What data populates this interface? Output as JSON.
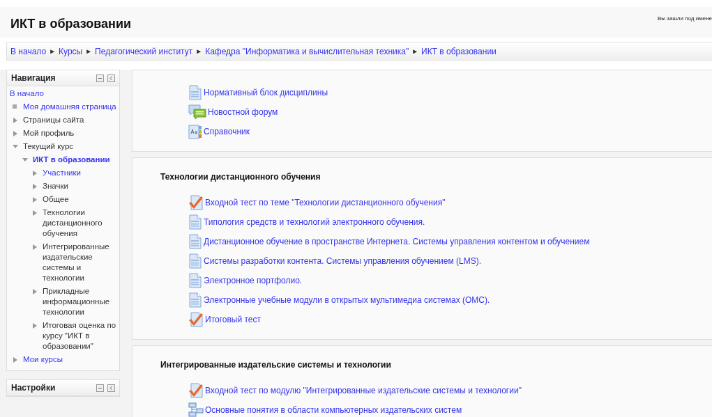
{
  "header": {
    "title": "ИКТ в образовании",
    "login_info": "Вы зашли под имене"
  },
  "breadcrumbs": [
    {
      "label": "В начало"
    },
    {
      "label": "Курсы"
    },
    {
      "label": "Педагогический институт"
    },
    {
      "label": "Кафедра \"Информатика и вычислительная техника\""
    },
    {
      "label": "ИКТ в образовании"
    }
  ],
  "breadcrumb_separator": "►",
  "navigation": {
    "title": "Навигация",
    "items": [
      {
        "label": "В начало",
        "kind": "root",
        "link": true,
        "selected": false
      },
      {
        "label": "Моя домашняя страница",
        "kind": "leaf",
        "link": true,
        "selected": false
      },
      {
        "label": "Страницы сайта",
        "kind": "branch",
        "expanded": false,
        "link": false,
        "selected": false
      },
      {
        "label": "Мой профиль",
        "kind": "branch",
        "expanded": false,
        "link": false,
        "selected": false
      },
      {
        "label": "Текущий курс",
        "kind": "branch",
        "expanded": true,
        "link": false,
        "selected": false,
        "children": [
          {
            "label": "ИКТ в образовании",
            "kind": "branch",
            "expanded": true,
            "link": true,
            "selected": true,
            "children": [
              {
                "label": "Участники",
                "kind": "branch",
                "expanded": false,
                "link": true,
                "selected": false
              },
              {
                "label": "Значки",
                "kind": "branch",
                "expanded": false,
                "link": false,
                "selected": false
              },
              {
                "label": "Общее",
                "kind": "branch",
                "expanded": false,
                "link": false,
                "selected": false
              },
              {
                "label": "Технологии дистанционного обучения",
                "kind": "branch",
                "expanded": false,
                "link": false,
                "selected": false
              },
              {
                "label": "Интегрированные издательские системы и технологии",
                "kind": "branch",
                "expanded": false,
                "link": false,
                "selected": false
              },
              {
                "label": "Прикладные информационные технологии",
                "kind": "branch",
                "expanded": false,
                "link": false,
                "selected": false
              },
              {
                "label": "Итоговая оценка по курсу \"ИКТ в образовании\"",
                "kind": "branch",
                "expanded": false,
                "link": false,
                "selected": false
              }
            ]
          }
        ]
      },
      {
        "label": "Мои курсы",
        "kind": "branch",
        "expanded": false,
        "link": true,
        "selected": false
      }
    ]
  },
  "settings": {
    "title": "Настройки"
  },
  "sections": [
    {
      "activities": [
        {
          "kind": "page",
          "label": "Нормативный блок дисциплины"
        },
        {
          "kind": "forum",
          "label": "Новостной форум"
        },
        {
          "kind": "glossary",
          "label": "Справочник"
        }
      ]
    },
    {
      "title": "Технологии дистанционного обучения",
      "activities": [
        {
          "kind": "quiz",
          "label": "Входной тест по теме \"Технологии дистанционного обучения\""
        },
        {
          "kind": "page",
          "label": "Типология средств и технологий электронного обучения."
        },
        {
          "kind": "page",
          "label": "Дистанционное обучение в пространстве Интернета. Системы управления контентом и обучением"
        },
        {
          "kind": "page",
          "label": "Системы разработки контента. Системы управления обучением (LMS)."
        },
        {
          "kind": "page",
          "label": "Электронное портфолио."
        },
        {
          "kind": "page",
          "label": "Электронные учебные модули в открытых мультимедиа системах (ОМС)."
        },
        {
          "kind": "quiz",
          "label": "Итоговый тест"
        }
      ]
    },
    {
      "title": "Интегрированные издательские системы и технологии",
      "activities": [
        {
          "kind": "quiz",
          "label": "Входной тест по модулю \"Интегрированные издательские системы и технологии\""
        },
        {
          "kind": "book",
          "label": "Основные понятия в области компьютерных издательских систем"
        }
      ]
    }
  ]
}
